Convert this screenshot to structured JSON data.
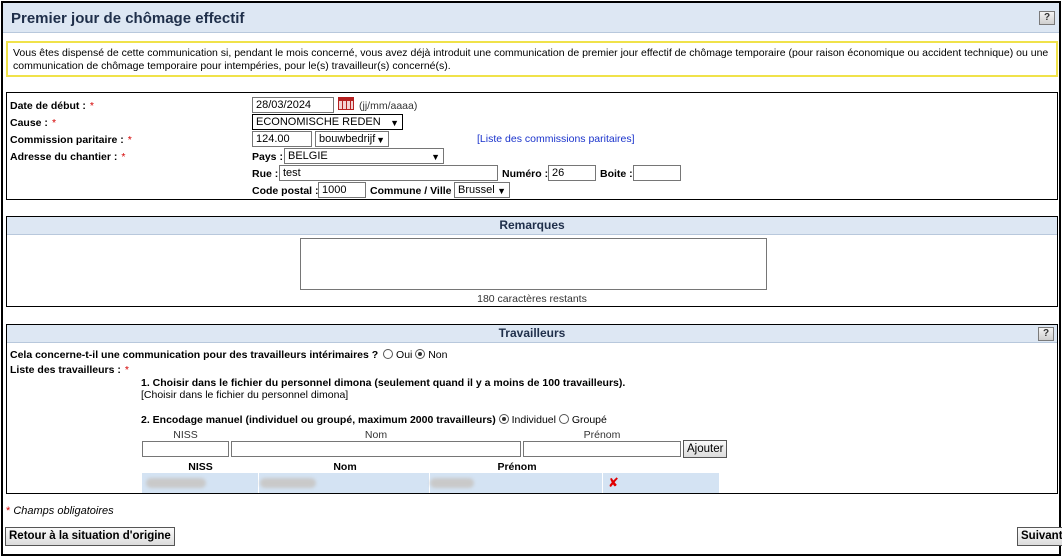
{
  "page": {
    "title": "Premier jour de chômage effectif",
    "help_icon": "help-icon",
    "notice": "Vous êtes dispensé de cette communication si, pendant le mois concerné, vous avez déjà introduit une communication de premier jour effectif de chômage temporaire (pour raison économique ou accident technique) ou une communication de chômage temporaire pour intempéries, pour le(s) travailleur(s) concerné(s)."
  },
  "form": {
    "start_date_label": "Date de début :",
    "start_date_value": "28/03/2024",
    "date_format_hint": "(jj/mm/aaaa)",
    "cause_label": "Cause :",
    "cause_value": "ECONOMISCHE REDEN",
    "joint_committee_label": "Commission paritaire :",
    "joint_committee_value": "124.00",
    "joint_committee_sub_value": "bouwbedrijf",
    "joint_committee_link": "[Liste des commissions paritaires]",
    "site_address_label": "Adresse du chantier :",
    "country_label": "Pays :",
    "country_value": "BELGIE",
    "street_label": "Rue :",
    "street_value": "test",
    "number_label": "Numéro :",
    "number_value": "26",
    "box_label": "Boite :",
    "box_value": "",
    "postal_code_label": "Code postal :",
    "postal_code_value": "1000",
    "city_label": "Commune / Ville :",
    "city_value": "Brussel",
    "required_marker": "*"
  },
  "remarks": {
    "header": "Remarques",
    "value": "",
    "chars_remaining": "180 caractères restants"
  },
  "workers": {
    "header": "Travailleurs",
    "temp_question": "Cela concerne-t-il une communication pour des travailleurs intérimaires ?",
    "temp_yes": "Oui",
    "temp_no": "Non",
    "list_label": "Liste des travailleurs :",
    "option1_title": "1. Choisir dans le fichier du personnel dimona (seulement quand il y a moins de 100 travailleurs).",
    "option1_link": "[Choisir dans le fichier du personnel dimona]",
    "option2_title": "2. Encodage manuel (individuel ou groupé, maximum 2000 travailleurs)",
    "mode_individual": "Individuel",
    "mode_group": "Groupé",
    "niss_header": "NISS",
    "nom_header": "Nom",
    "prenom_header": "Prénom",
    "add_button": "Ajouter",
    "table_headers": [
      "NISS",
      "Nom",
      "Prénom"
    ],
    "delete_icon": "delete-x-icon"
  },
  "footer": {
    "required_note": "Champs obligatoires",
    "back_button": "Retour à la situation d'origine",
    "next_button": "Suivant"
  }
}
